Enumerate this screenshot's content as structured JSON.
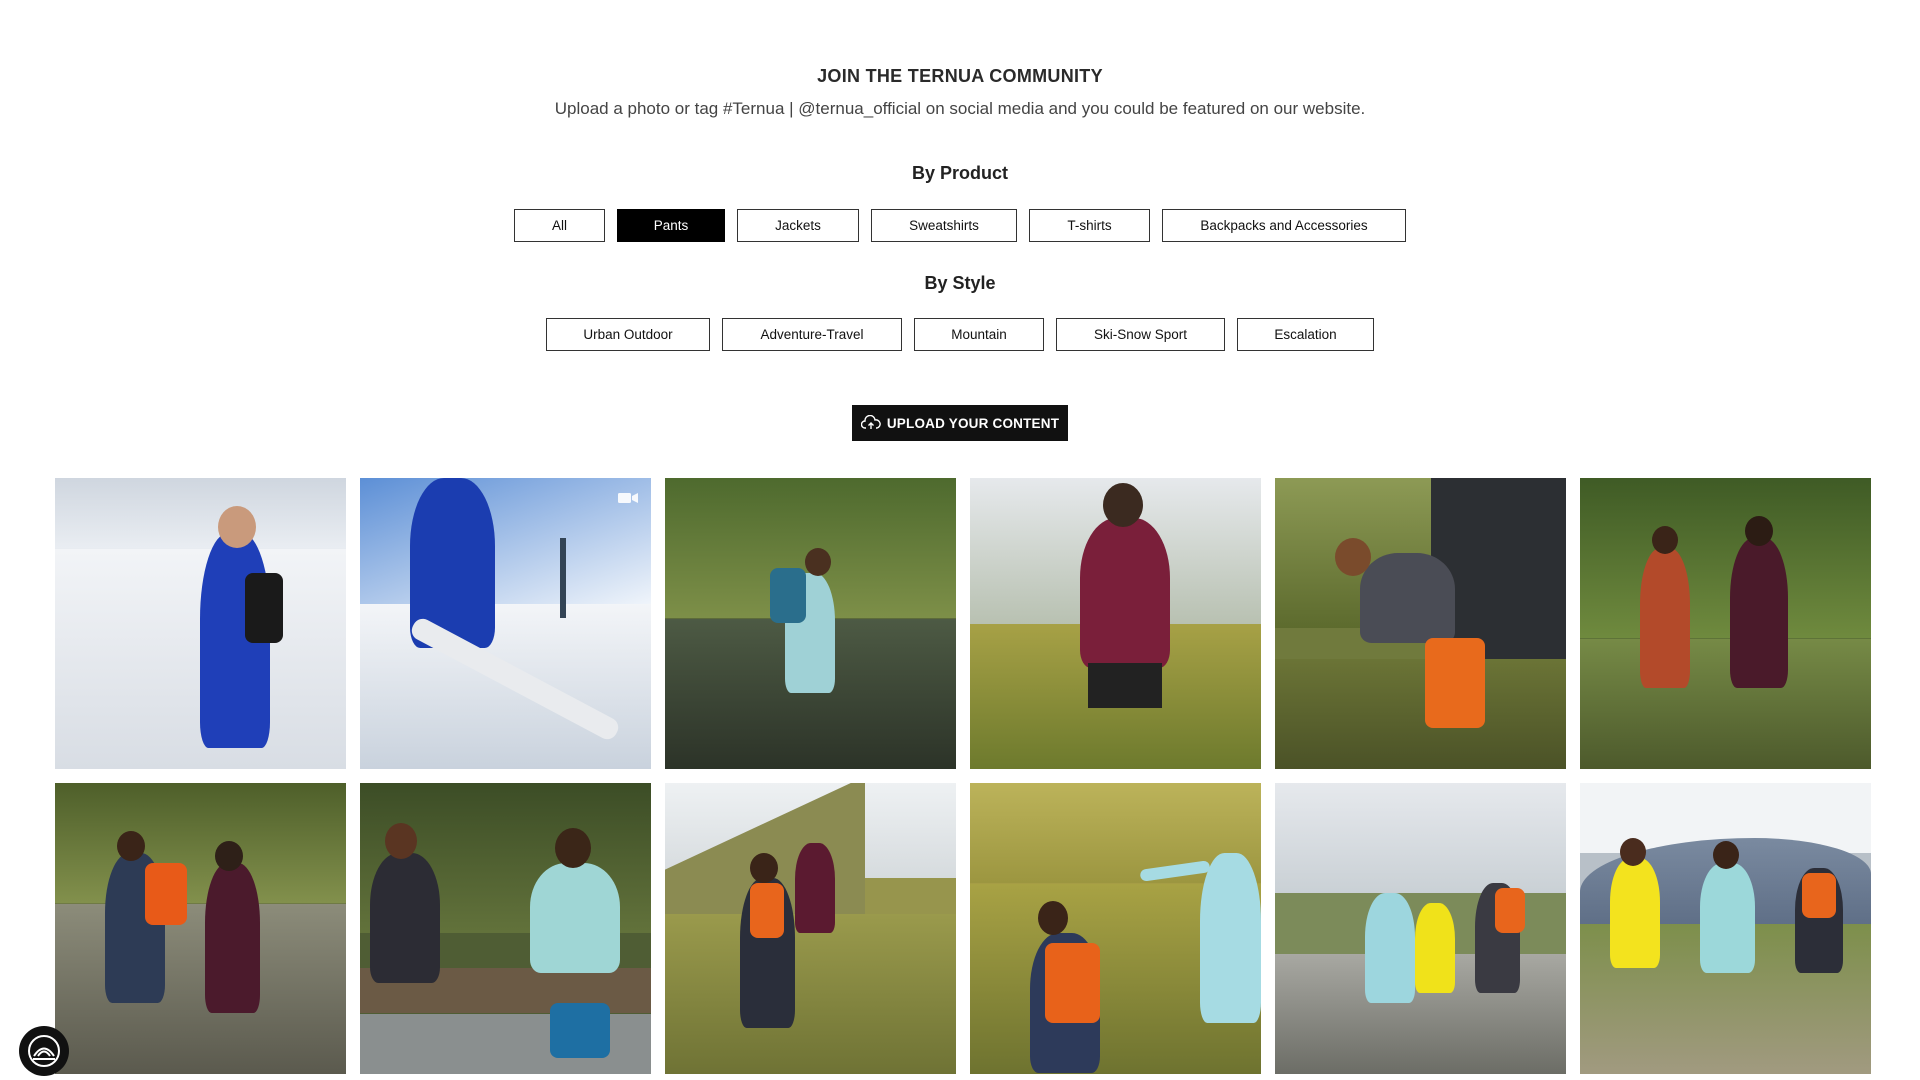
{
  "header": {
    "title": "JOIN THE TERNUA COMMUNITY",
    "subtitle": "Upload a photo or tag #Ternua | @ternua_official on social media and you could be featured on our website."
  },
  "filters": {
    "by_product_label": "By Product",
    "product_options": [
      "All",
      "Pants",
      "Jackets",
      "Sweatshirts",
      "T-shirts",
      "Backpacks and Accessories"
    ],
    "product_selected": "Pants",
    "by_style_label": "By Style",
    "style_options": [
      "Urban Outdoor",
      "Adventure-Travel",
      "Mountain",
      "Ski-Snow Sport",
      "Escalation"
    ]
  },
  "upload": {
    "label": "UPLOAD YOUR CONTENT",
    "icon": "cloud-upload-icon"
  },
  "gallery": {
    "tiles": [
      {
        "scene": "skier-blue-suit-snow",
        "video": false
      },
      {
        "scene": "skier-pov-ski-lift",
        "video": true
      },
      {
        "scene": "hiker-crossing-stream",
        "video": false
      },
      {
        "scene": "man-red-jacket-hillside",
        "video": false
      },
      {
        "scene": "woman-tying-boots-by-van",
        "video": false
      },
      {
        "scene": "two-hikers-forest-path",
        "video": false
      },
      {
        "scene": "two-hikers-rocky-trail",
        "video": false
      },
      {
        "scene": "hikers-resting-on-log",
        "video": false
      },
      {
        "scene": "hikers-ascending-slope",
        "video": false
      },
      {
        "scene": "hikers-pointing-view",
        "video": false
      },
      {
        "scene": "hikers-high-five-summit",
        "video": false
      },
      {
        "scene": "three-hikers-meadow",
        "video": false
      }
    ]
  },
  "colors": {
    "accent": "#000000",
    "button_border": "#333333"
  },
  "floating_logo": {
    "icon": "ternua-logo-icon"
  }
}
